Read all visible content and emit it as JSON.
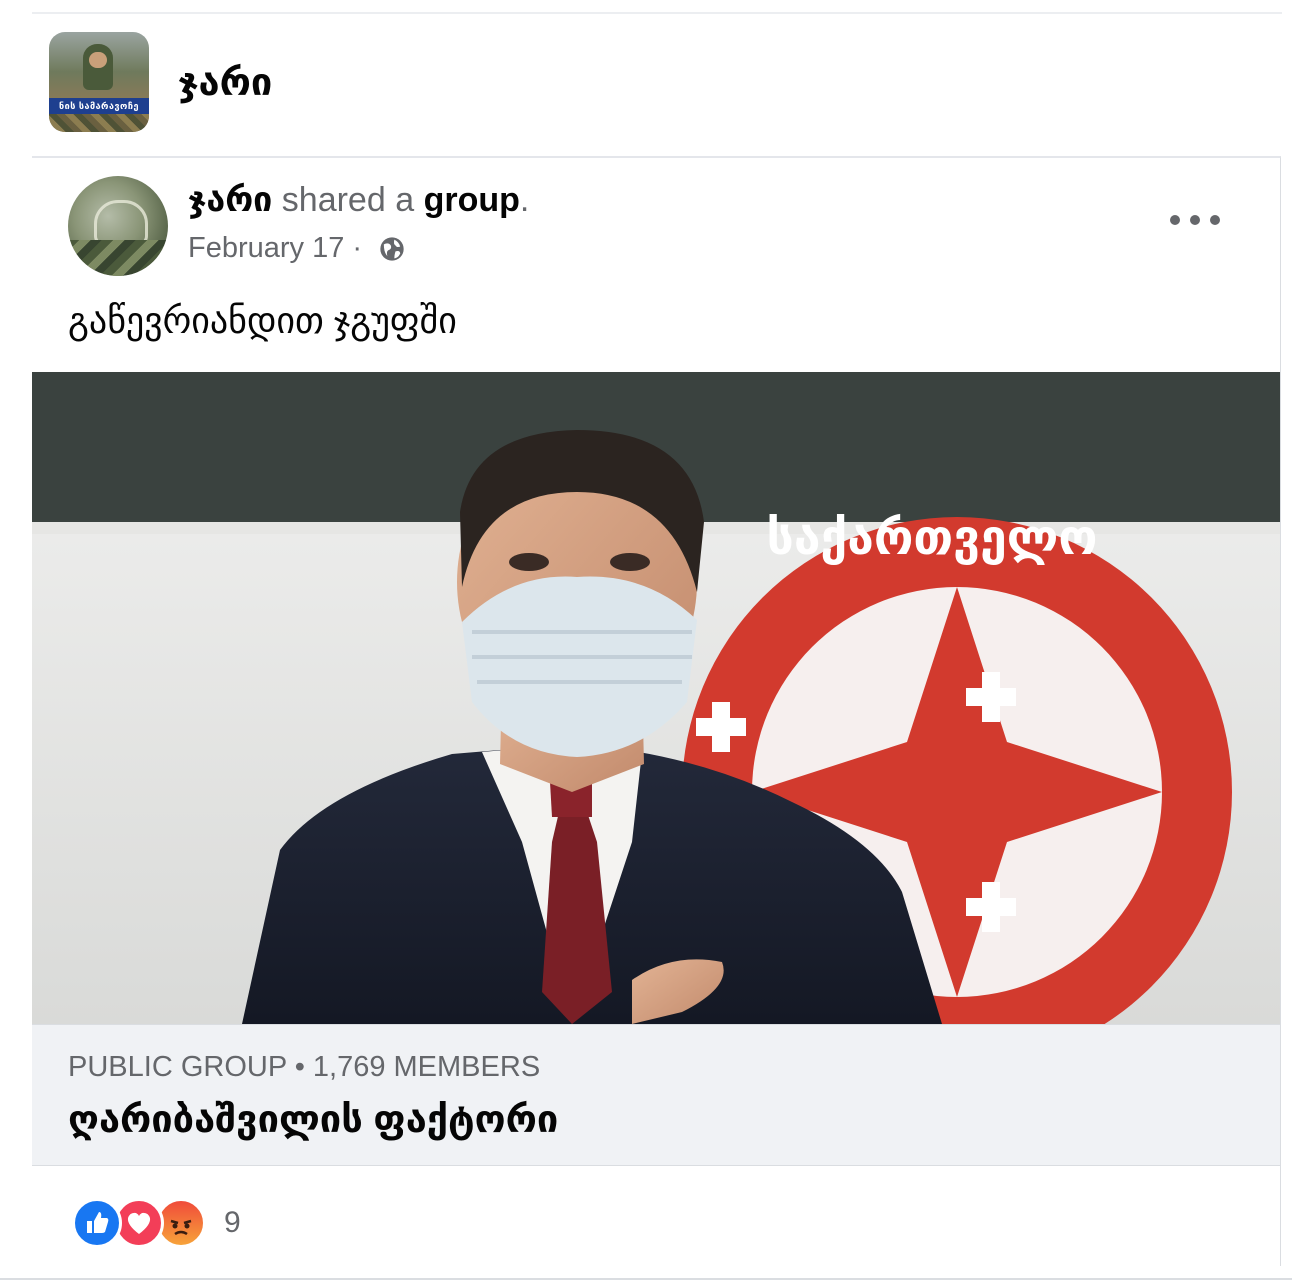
{
  "page_header": {
    "name": "ჯარი",
    "avatar_banner": "ნის სამარავოჩე"
  },
  "post": {
    "author": "ჯარი",
    "action": " shared a ",
    "object": "group",
    "period": ".",
    "date": "February 17",
    "date_separator": " · ",
    "audience_icon": "globe-icon",
    "text": "გაწევრიანდით ჯგუფში"
  },
  "hero_image": {
    "emblem_text": "საქართველო"
  },
  "link_preview": {
    "subtitle": "PUBLIC GROUP • 1,769 MEMBERS",
    "title": "ღარიბაშვილის ფაქტორი"
  },
  "reactions": {
    "icons": [
      "like-icon",
      "love-icon",
      "angry-icon"
    ],
    "count": "9"
  },
  "colors": {
    "accent": "#1877f2",
    "love": "#f33e58",
    "emblem_red": "#d23a2e",
    "secondary_text": "#65676b"
  }
}
